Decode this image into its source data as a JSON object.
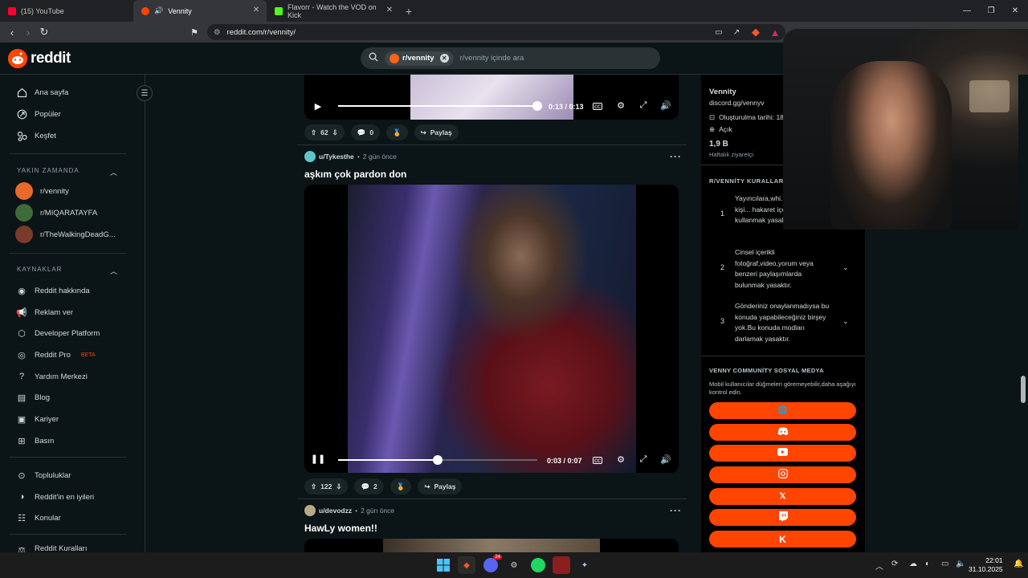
{
  "browser": {
    "tabs": [
      {
        "label": "(15) YouTube",
        "active": false,
        "favicon_color": "#ff0033"
      },
      {
        "label": "Vennity",
        "active": true,
        "favicon_color": "#ff4500"
      },
      {
        "label": "Flavorr - Watch the VOD on Kick",
        "active": false,
        "favicon_color": "#53fc18"
      }
    ],
    "url": "reddit.com/r/vennity/"
  },
  "header": {
    "logo_text": "reddit",
    "search": {
      "chip_label": "r/vennity",
      "placeholder": "r/vennity içinde ara"
    }
  },
  "sidebar": {
    "main": [
      {
        "label": "Ana sayfa",
        "icon": "home-icon"
      },
      {
        "label": "Popüler",
        "icon": "popular-icon"
      },
      {
        "label": "Keşfet",
        "icon": "explore-icon"
      }
    ],
    "recent_heading": "YAKIN ZAMANDA",
    "recent": [
      {
        "label": "r/vennity",
        "color": "#e8692a"
      },
      {
        "label": "r/MIQARATAYFA",
        "color": "#3f6b3a"
      },
      {
        "label": "r/TheWalkingDeadG...",
        "color": "#7a3b2a"
      }
    ],
    "resources_heading": "KAYNAKLAR",
    "resources": [
      {
        "label": "Reddit hakkında",
        "icon": "reddit-icon"
      },
      {
        "label": "Reklam ver",
        "icon": "megaphone-icon"
      },
      {
        "label": "Developer Platform",
        "icon": "developer-icon"
      },
      {
        "label": "Reddit Pro",
        "icon": "pro-icon",
        "badge": "BETA"
      },
      {
        "label": "Yardım Merkezi",
        "icon": "help-icon"
      },
      {
        "label": "Blog",
        "icon": "book-icon"
      },
      {
        "label": "Kariyer",
        "icon": "briefcase-icon"
      },
      {
        "label": "Basın",
        "icon": "press-icon"
      }
    ],
    "more": [
      {
        "label": "Topluluklar",
        "icon": "communities-icon"
      },
      {
        "label": "Reddit'in en iyileri",
        "icon": "best-icon"
      },
      {
        "label": "Konular",
        "icon": "topics-icon"
      },
      {
        "label": "Reddit Kuralları",
        "icon": "rules-icon"
      }
    ]
  },
  "posts": [
    {
      "video": {
        "time": "0:13 / 0:13",
        "progress": 1.0,
        "state": "paused"
      },
      "votes": "62",
      "comments": "0",
      "share": "Paylaş"
    },
    {
      "user": "u/Tykesthe",
      "time": "2 gün önce",
      "title": "aşkım çok pardon don",
      "video": {
        "time": "0:03 / 0:07",
        "progress": 0.5,
        "state": "playing"
      },
      "votes": "122",
      "comments": "2",
      "share": "Paylaş"
    },
    {
      "user": "u/devodzz",
      "time": "2 gün önce",
      "title": "HawLy women!!"
    }
  ],
  "community": {
    "name": "Vennity",
    "link": "discord.gg/vennyv",
    "created": "Oluşturulma tarihi: 18",
    "status": "Açık",
    "visitors": "1,9 B",
    "visitors_label": "Haftalık ziyaretçi",
    "rules_heading": "R/VENNİTY KURALLARI",
    "rules": [
      {
        "num": "1",
        "text": "Yayıncılara,whi... herhangi bir kişi... hakaret içeren ifade... kullanmak yasaktır."
      },
      {
        "num": "2",
        "text": "Cinsel içerikli fotoğraf,video,yorum veya benzeri paylaşımlarda bulunmak yasaktır."
      },
      {
        "num": "3",
        "text": "Gönderiniz onaylanmadıysa bu konuda yapabileceğiniz birşey yok.Bu konuda modları darlamak yasaktır."
      }
    ],
    "social_heading": "VENNY COMMUNİTY SOSYAL MEDYA",
    "social_note": "Mobil kullanıcılar düğmeleri göremeyebilir,daha aşağıyı kontrol edin.",
    "social_buttons": [
      "globe-icon",
      "discord-icon",
      "youtube-icon",
      "instagram-icon",
      "x-icon",
      "twitch-icon",
      "kick-icon"
    ],
    "accent": "#ff4500"
  },
  "taskbar": {
    "clock_time": "22:01",
    "clock_date": "31.10.2025",
    "discord_badge": "24"
  }
}
